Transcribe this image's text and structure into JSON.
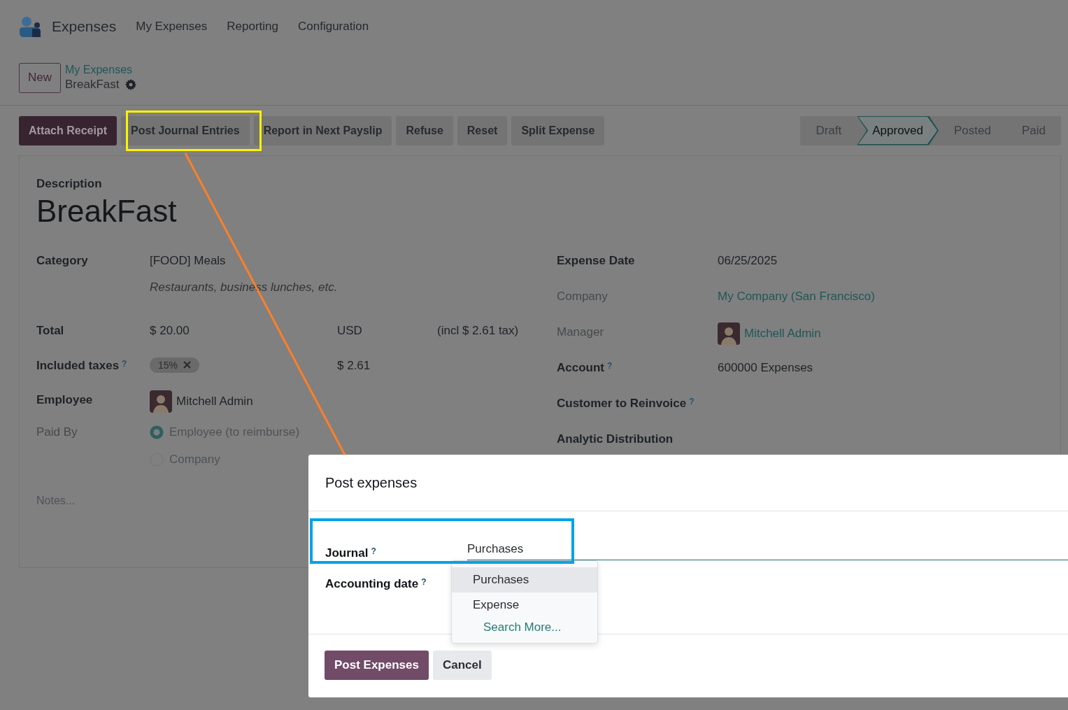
{
  "app": {
    "name": "Expenses"
  },
  "menu": [
    {
      "label": "My Expenses"
    },
    {
      "label": "Reporting"
    },
    {
      "label": "Configuration"
    }
  ],
  "breadcrumb": {
    "new_button": "New",
    "parent": "My Expenses",
    "current": "BreakFast"
  },
  "actions": [
    {
      "label": "Attach Receipt",
      "kind": "primary"
    },
    {
      "label": "Post Journal Entries",
      "kind": "secondary"
    },
    {
      "label": "Report in Next Payslip",
      "kind": "secondary"
    },
    {
      "label": "Refuse",
      "kind": "secondary"
    },
    {
      "label": "Reset",
      "kind": "secondary"
    },
    {
      "label": "Split Expense",
      "kind": "secondary"
    }
  ],
  "stages": [
    {
      "label": "Draft",
      "selected": false
    },
    {
      "label": "Approved",
      "selected": true
    },
    {
      "label": "Posted",
      "selected": false
    },
    {
      "label": "Paid",
      "selected": false
    }
  ],
  "form": {
    "description_label": "Description",
    "title": "BreakFast",
    "category": {
      "label": "Category",
      "value": "[FOOD] Meals",
      "note": "Restaurants, business lunches, etc."
    },
    "total": {
      "label": "Total",
      "amount": "$ 20.00",
      "currency": "USD",
      "tax_note": "(incl $ 2.61 tax)"
    },
    "taxes": {
      "label": "Included taxes",
      "help": "?",
      "tag": "15%",
      "amount": "$ 2.61"
    },
    "employee": {
      "label": "Employee",
      "name": "Mitchell Admin"
    },
    "paid_by": {
      "label": "Paid By",
      "options": [
        {
          "label": "Employee (to reimburse)",
          "selected": true
        },
        {
          "label": "Company",
          "selected": false
        }
      ]
    },
    "notes": {
      "placeholder": "Notes..."
    },
    "right_fields": [
      {
        "label": "Expense Date",
        "value": "06/25/2025",
        "kind": "text",
        "readonly": false
      },
      {
        "label": "Company",
        "value": "My Company (San Francisco)",
        "kind": "link",
        "readonly": true
      },
      {
        "label": "Manager",
        "value": "Mitchell Admin",
        "kind": "person",
        "readonly": true
      },
      {
        "label": "Account",
        "help": "?",
        "value": "600000 Expenses",
        "kind": "text",
        "readonly": false
      },
      {
        "label": "Customer to Reinvoice",
        "help": "?",
        "kind": "empty",
        "readonly": false
      },
      {
        "label": "Analytic Distribution",
        "kind": "empty",
        "readonly": false
      }
    ]
  },
  "dialog": {
    "title": "Post expenses",
    "journal": {
      "label": "Journal",
      "help": "?",
      "value": "Purchases"
    },
    "accounting_date": {
      "label": "Accounting date",
      "help": "?"
    },
    "dropdown": {
      "options": [
        {
          "label": "Purchases",
          "selected": true
        },
        {
          "label": "Expense",
          "selected": false
        }
      ],
      "search_more": "Search More..."
    },
    "buttons": [
      {
        "label": "Post Expenses",
        "kind": "primary"
      },
      {
        "label": "Cancel",
        "kind": "secondary"
      }
    ]
  }
}
